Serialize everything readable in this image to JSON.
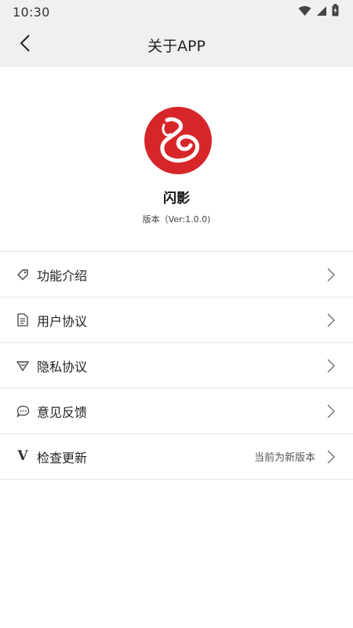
{
  "status_bar": {
    "time": "10:30",
    "icons": [
      "wifi-icon",
      "signal-icon",
      "battery-icon"
    ]
  },
  "nav": {
    "back_icon": "back-arrow-icon",
    "title": "关于APP"
  },
  "app": {
    "logo_icon": "app-logo-icon",
    "name": "闪影",
    "version": "版本（Ver:1.0.0)"
  },
  "menu": [
    {
      "icon": "tag-icon",
      "label": "功能介绍",
      "hint": ""
    },
    {
      "icon": "document-icon",
      "label": "用户协议",
      "hint": ""
    },
    {
      "icon": "shield-icon",
      "label": "隐私协议",
      "hint": ""
    },
    {
      "icon": "chat-bubble-icon",
      "label": "意见反馈",
      "hint": ""
    },
    {
      "icon": "v-letter-icon",
      "icon_text": "V",
      "label": "检查更新",
      "hint": "当前为新版本"
    }
  ],
  "colors": {
    "bar_bg": "#f0f0f0",
    "logo_red": "#d7262a",
    "divider": "#e6e6e6"
  }
}
